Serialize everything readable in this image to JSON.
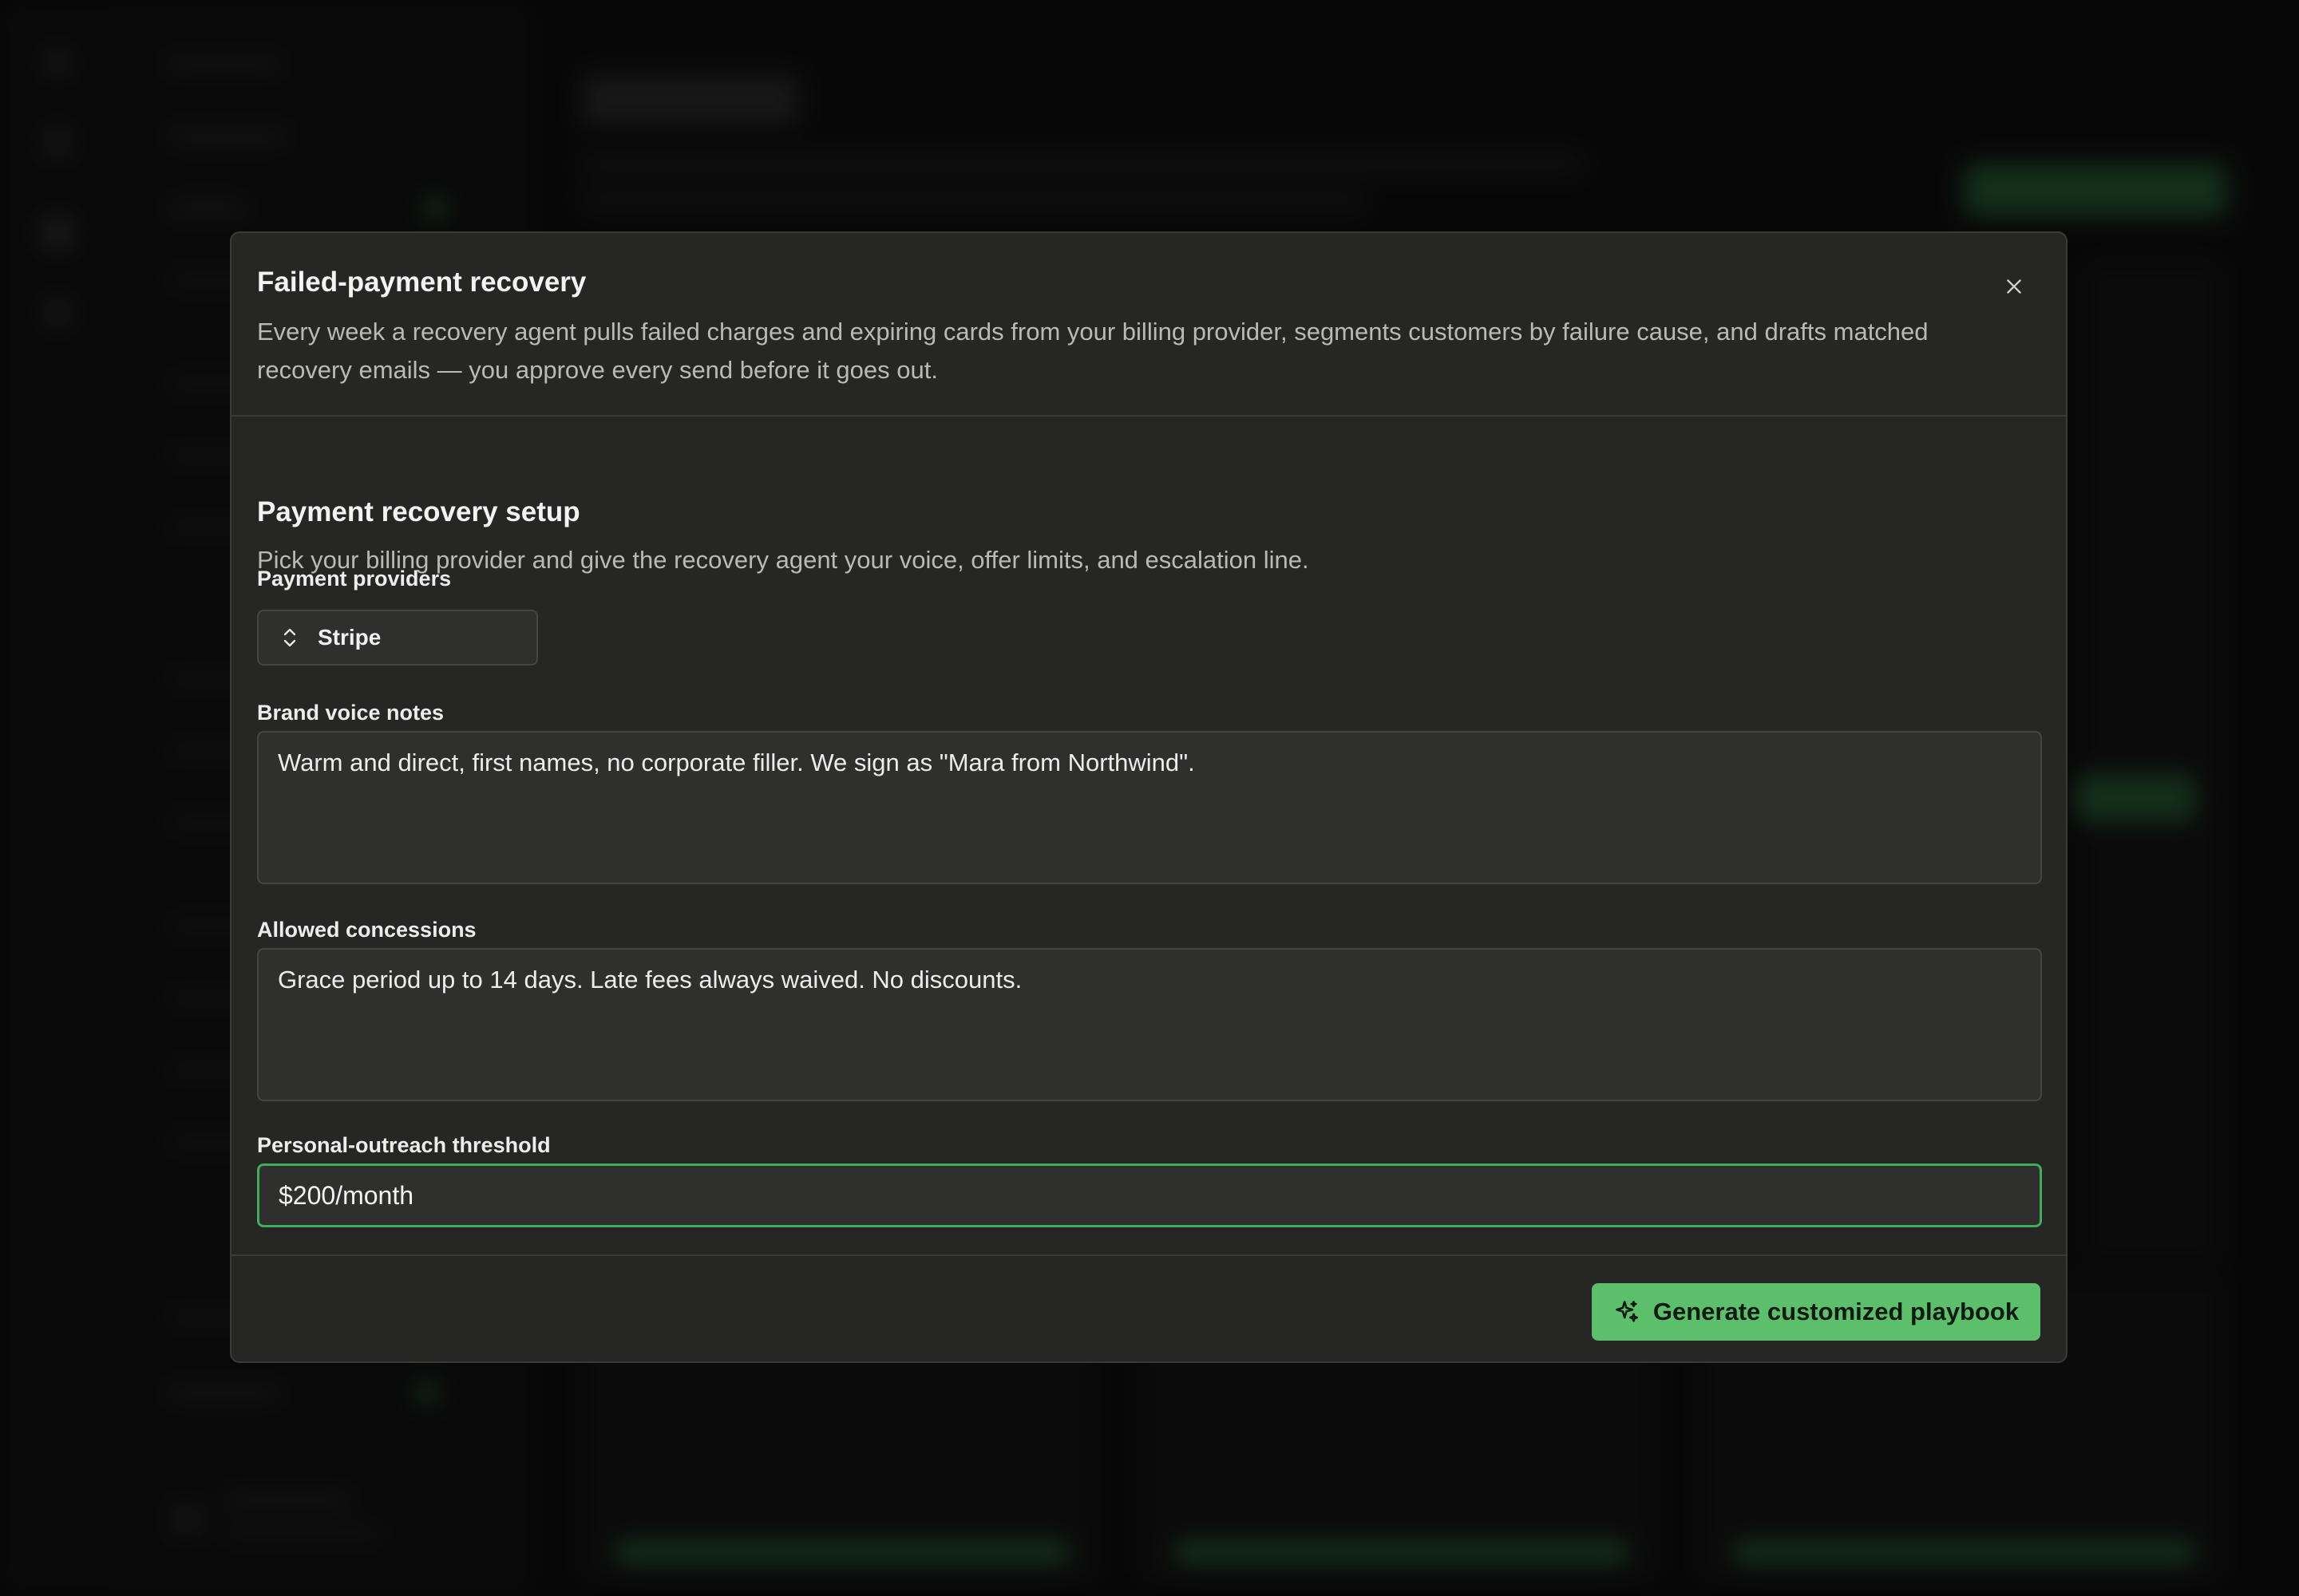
{
  "modal": {
    "title": "Failed-payment recovery",
    "description": "Every week a recovery agent pulls failed charges and expiring cards from your billing provider, segments customers by failure cause, and drafts matched recovery emails — you approve every send before it goes out.",
    "close_icon": "close-icon"
  },
  "setup": {
    "title": "Payment recovery setup",
    "description": "Pick your billing provider and give the recovery agent your voice, offer limits, and escalation line.",
    "providers": {
      "label": "Payment providers",
      "selected": "Stripe",
      "icon": "chevron-up-down-icon"
    },
    "brand_voice": {
      "label": "Brand voice notes",
      "value": "Warm and direct, first names, no corporate filler. We sign as \"Mara from Northwind\"."
    },
    "concessions": {
      "label": "Allowed concessions",
      "value": "Grace period up to 14 days. Late fees always waived. No discounts."
    },
    "threshold": {
      "label": "Personal-outreach threshold",
      "value": "$200/month"
    }
  },
  "footer": {
    "generate_label": "Generate customized playbook",
    "generate_icon": "sparkles-icon"
  },
  "colors": {
    "accent": "#5bbf6b",
    "focus_border": "#3fae5c",
    "modal_bg": "#262625"
  }
}
